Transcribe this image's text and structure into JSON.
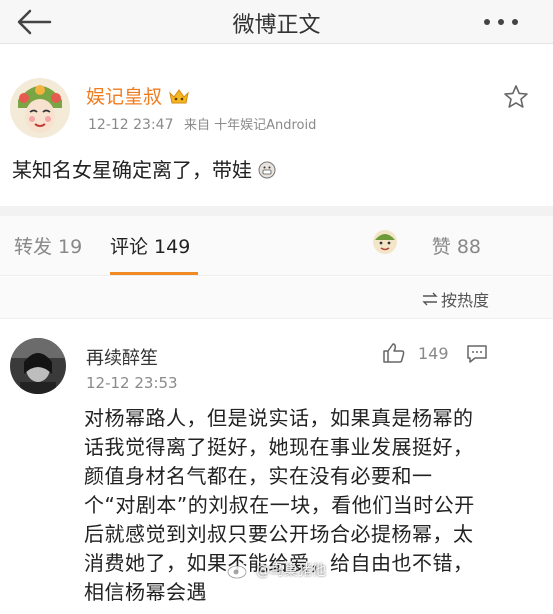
{
  "nav": {
    "title": "微博正文",
    "back_icon": "back-arrow-icon",
    "more_icon": "more-dots-icon",
    "background": "#f7f7f7"
  },
  "post": {
    "author": "娱记皇叔",
    "author_color": "#f07c20",
    "time": "12-12 23:47",
    "source": "来自 十年娱记Android",
    "text": "某知名女星确定离了，带娃",
    "star_icon": "star-outline-icon"
  },
  "tabs": {
    "repost": "转发 19",
    "comment": "评论 149",
    "like": "赞 88",
    "accent": "#f08a24"
  },
  "sort": {
    "label": "按热度"
  },
  "comment": {
    "author": "再续醉笙",
    "time": "12-12 23:53",
    "likes": "149",
    "body": "对杨幂路人，但是说实话，如果真是杨幂的话我觉得离了挺好，她现在事业发展挺好，颜值身材名气都在，实在没有必要和一个“对剧本”的刘叔在一块，看他们当时公开后就感觉到刘叔只要公开场合必提杨幂，太消费她了，如果不能给爱，给自由也不错，相信杨幂会遇"
  },
  "watermark": {
    "text": "@鸟巢猪他"
  }
}
